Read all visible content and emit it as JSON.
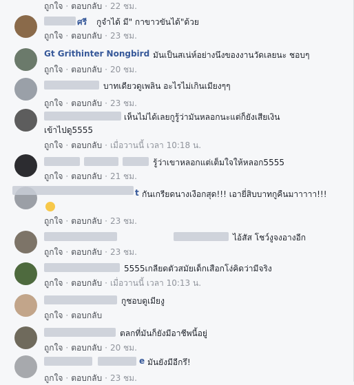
{
  "actions": {
    "like": "ถูกใจ",
    "reply": "ตอบกลับ",
    "sep": "·"
  },
  "comments": [
    {
      "name": "ศรี",
      "text": "กูจำได้ มี\" กาขาวขันได้\"ด้วย",
      "time": "22 ชม."
    },
    {
      "name": "",
      "text": "",
      "time": "23 ชม."
    },
    {
      "name": "Gt Grithinter Nongbird",
      "text": "มันเป็นสเน่ห์อย่างนึงของงานวัดเลยนะ ชอบๆ",
      "time": "20 ชม."
    },
    {
      "name": "",
      "text": "บาทเดียวดูเพลิน อะไรไม่เกินเมียงๆๆ",
      "time": "23 ชม."
    },
    {
      "name": "",
      "text_line1": "เห็นไม่ได้เลยกูรู้ว่ามันหลอกนะแต่ก็ยังเสียเงิน",
      "text_line2": "เข้าไปดู5555",
      "time": "เมื่อวานนี้ เวลา 10:18 น."
    },
    {
      "name": "",
      "text": "รู้ว่าเขาหลอกแต่เต็มใจให้หลอก5555",
      "time": "21 ชม."
    },
    {
      "name": "t",
      "text": "กันเกรียดนางเงือกสุด!!! เอายี่สิบบาทกูคืนมาาาาา!!!",
      "time": "23 ชม."
    },
    {
      "name": "",
      "text": "ไอ้สัส โชว์งูจงอางอีก",
      "time": "23 ชม."
    },
    {
      "name": "",
      "text": "5555เกลียดตัวสมัยเด็กเสือกโง่คิดว่ามีจริง",
      "time": "เมื่อวานนี้ เวลา 10:13 น."
    },
    {
      "name": "",
      "text": "กูชอบดูเมียงู",
      "time": ""
    },
    {
      "name": "",
      "text": "ตลกที่มันก็ยังมีอาชีพนี้อยู่",
      "time": "20 ชม."
    },
    {
      "name": "e",
      "text": "มันยังมีอีกรึ!",
      "time": "23 ชม."
    }
  ]
}
